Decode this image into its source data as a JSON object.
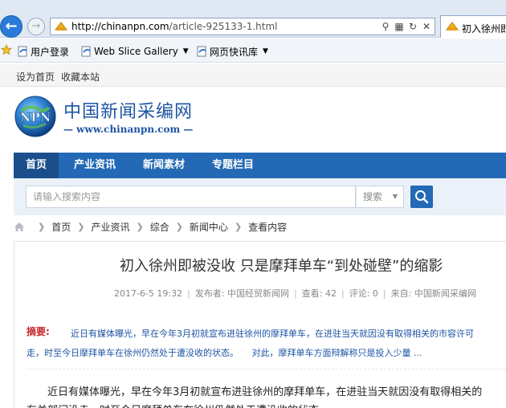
{
  "browser": {
    "url_domain": "chinanpn.com",
    "url_prefix": "http://",
    "url_path": "/article-925133-1.html",
    "tab_title": "初入徐州即",
    "favorites": [
      {
        "label": "用户登录"
      },
      {
        "label": "Web Slice Gallery"
      },
      {
        "label": "网页快讯库"
      }
    ]
  },
  "topbar": {
    "set_home": "设为首页",
    "bookmark": "收藏本站"
  },
  "logo": {
    "abbr": "NPN",
    "name_cn": "中国新闻采编网",
    "site_en": "— www.chinanpn.com —"
  },
  "nav": {
    "items": [
      {
        "label": "首页"
      },
      {
        "label": "产业资讯"
      },
      {
        "label": "新闻素材"
      },
      {
        "label": "专题栏目"
      }
    ]
  },
  "search": {
    "placeholder": "请输入搜索内容",
    "select_value": "搜索"
  },
  "breadcrumb": {
    "items": [
      "首页",
      "产业资讯",
      "综合",
      "新闻中心",
      "查看内容"
    ]
  },
  "article": {
    "title": "初入徐州即被没收 只是摩拜单车“到处碰壁”的缩影",
    "date": "2017-6-5 19:32",
    "publisher": "发布者: 中国经贸新闻网",
    "views": "查看: 42",
    "comments": "评论: 0",
    "source": "来自: 中国新闻采编网",
    "summary_label": "摘要:",
    "summary_line1": "近日有媒体曝光，早在今年3月初就宣布进驻徐州的摩拜单车，在进驻当天就因没有取得相关的市容许可",
    "summary_line2": "走，时至今日摩拜单车在徐州仍然处于遭没收的状态。　　对此，摩拜单车方面辩解称只是投入少量 ...",
    "body_line1": "近日有媒体曝光，早在今年3月初就宣布进驻徐州的摩拜单车，在进驻当天就因没有取得相关的",
    "body_line2": "有关部门没走，时至今日摩拜单车在徐州仍然处于遭没收的状态。"
  },
  "colors": {
    "nav_blue": "#2369b5",
    "nav_active": "#1a4f8c",
    "brand_blue": "#1e55a4",
    "summary_red": "#c5282a"
  }
}
